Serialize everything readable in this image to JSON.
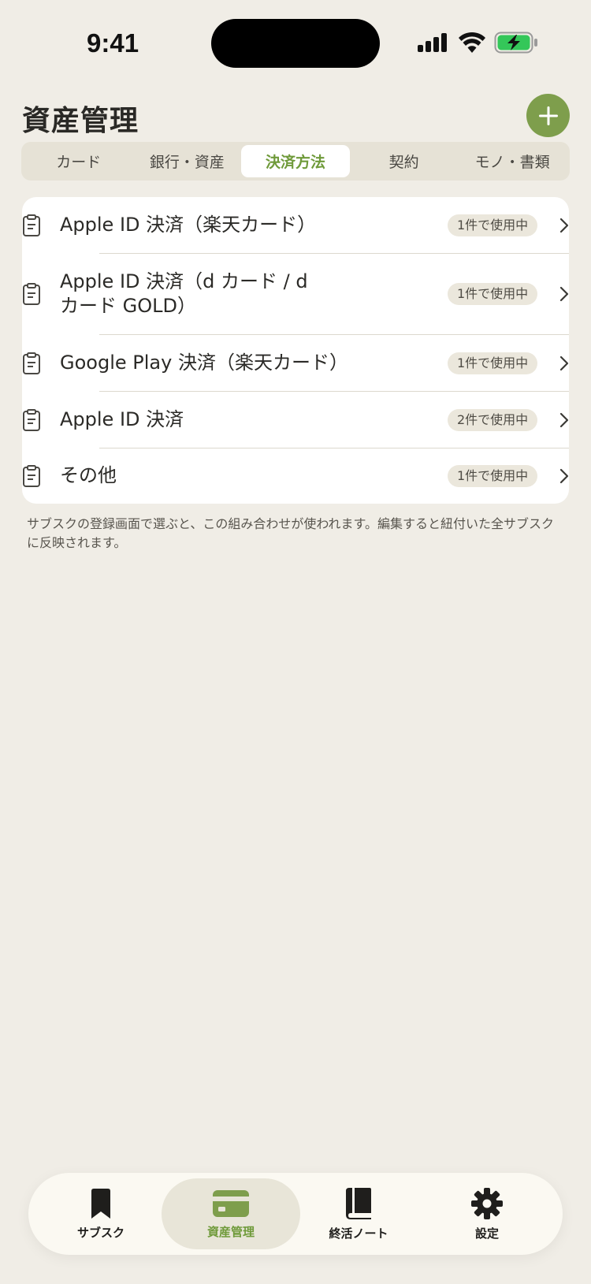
{
  "status_bar": {
    "time": "9:41"
  },
  "header": {
    "title": "資産管理",
    "add_icon": "plus-icon"
  },
  "tabs": [
    {
      "label": "カード",
      "active": false
    },
    {
      "label": "銀行・資産",
      "active": false
    },
    {
      "label": "決済方法",
      "active": true
    },
    {
      "label": "契約",
      "active": false
    },
    {
      "label": "モノ・書類",
      "active": false
    }
  ],
  "payment_methods": [
    {
      "label": "Apple ID 決済（楽天カード）",
      "usage": "1件で使用中"
    },
    {
      "label": "Apple ID 決済（d カード / d カード GOLD）",
      "usage": "1件で使用中"
    },
    {
      "label": "Google Play 決済（楽天カード）",
      "usage": "1件で使用中"
    },
    {
      "label": "Apple ID 決済",
      "usage": "2件で使用中"
    },
    {
      "label": "その他",
      "usage": "1件で使用中"
    }
  ],
  "footnote": "サブスクの登録画面で選ぶと、この組み合わせが使われます。編集すると紐付いた全サブスクに反映されます。",
  "bottom_nav": [
    {
      "label": "サブスク",
      "icon": "bookmark-icon",
      "active": false
    },
    {
      "label": "資産管理",
      "icon": "credit-card-icon",
      "active": true
    },
    {
      "label": "終活ノート",
      "icon": "book-icon",
      "active": false
    },
    {
      "label": "設定",
      "icon": "gear-icon",
      "active": false
    }
  ],
  "colors": {
    "background": "#f0ede6",
    "accent": "#7e9e4c",
    "accent_text": "#6f9a3a",
    "battery_fill": "#34c759"
  }
}
